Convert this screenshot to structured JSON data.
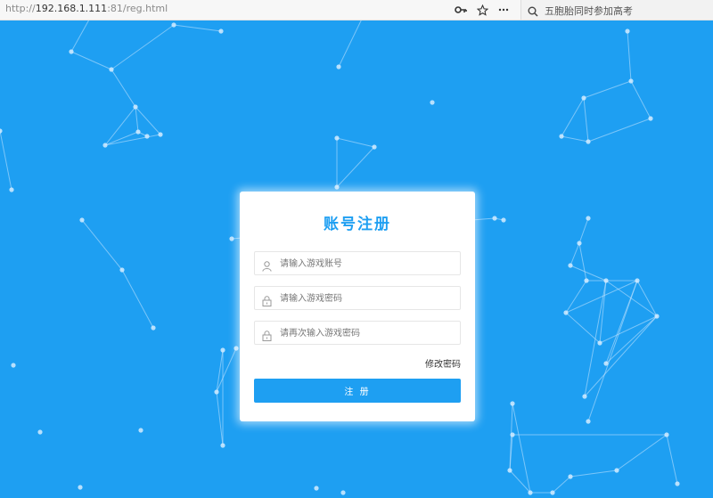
{
  "browser": {
    "url_prefix": "http://",
    "url_host": "192.168.1.111",
    "url_rest": ":81/reg.html",
    "search_query": "五胞胎同时参加高考",
    "icons": [
      "key-icon",
      "star-icon",
      "more-icon",
      "search-icon"
    ]
  },
  "form": {
    "title": "账号注册",
    "account_placeholder": "请输入游戏账号",
    "password_placeholder": "请输入游戏密码",
    "confirm_placeholder": "请再次输入游戏密码",
    "change_password_link": "修改密码",
    "submit_label": "注 册"
  },
  "colors": {
    "background": "#1e9ff2",
    "accent": "#1e9ff2",
    "card": "#ffffff"
  }
}
